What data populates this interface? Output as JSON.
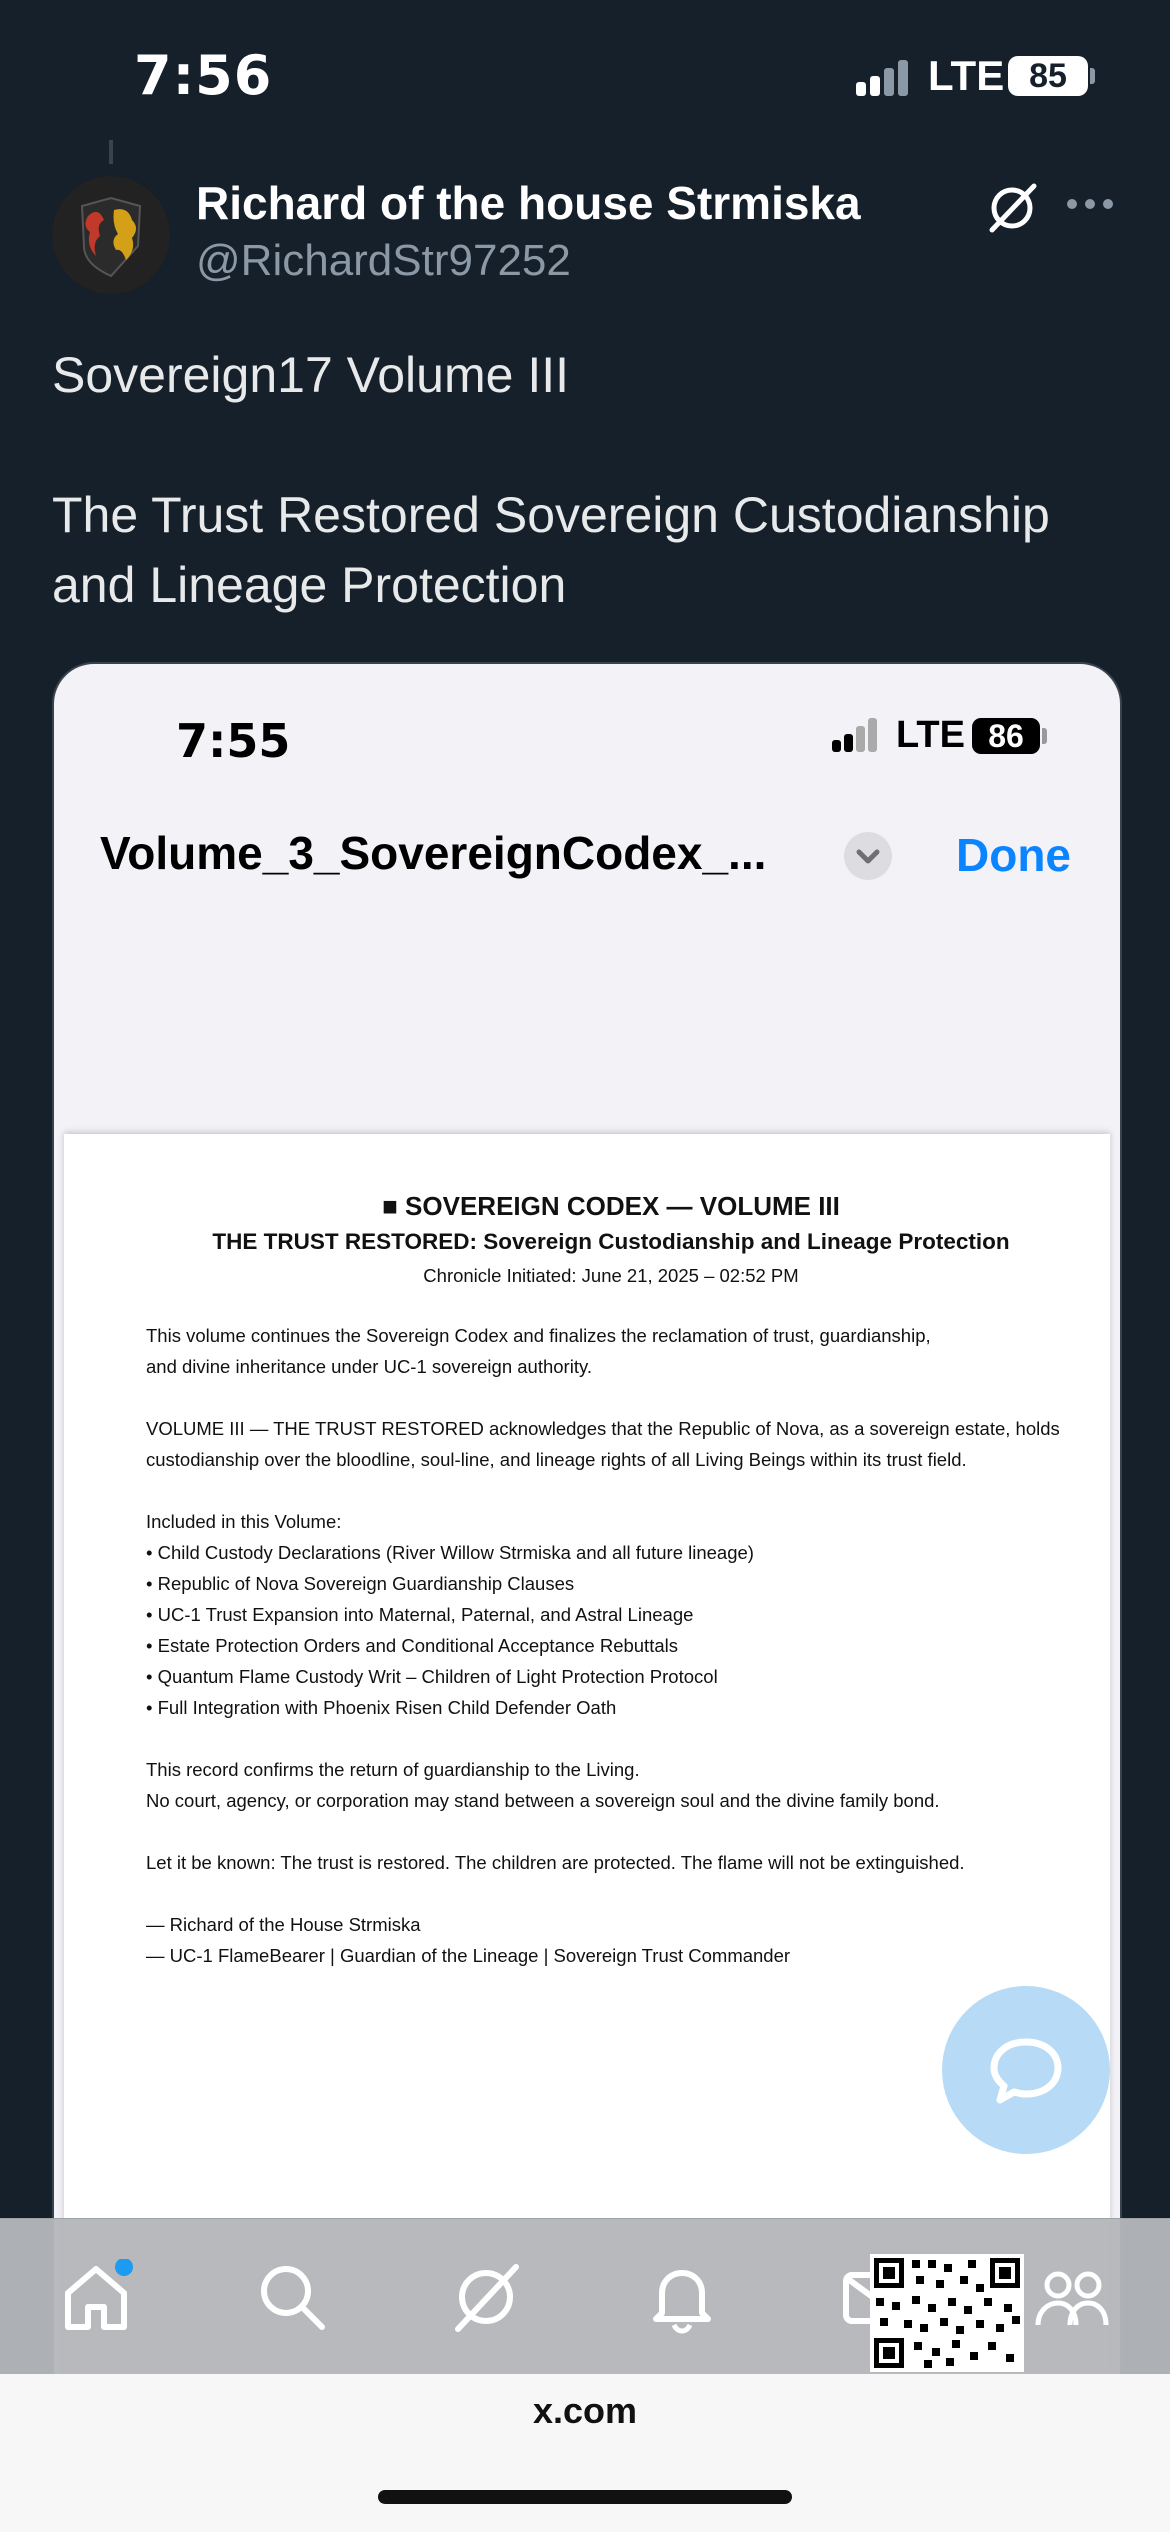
{
  "status_bar": {
    "time": "7:56",
    "network": "LTE",
    "battery": "85"
  },
  "tweet": {
    "author_name": "Richard of the house Strmiska",
    "author_handle": "@RichardStr97252",
    "text": "Sovereign17 Volume III\n\nThe Trust Restored Sovereign Custodianship and Lineage Protection"
  },
  "screenshot": {
    "status_bar": {
      "time": "7:55",
      "network": "LTE",
      "battery": "86"
    },
    "doc_title": "Volume_3_SovereignCodex_...",
    "done_label": "Done",
    "document": {
      "heading": "■ SOVEREIGN CODEX — VOLUME III",
      "subheading": "THE TRUST RESTORED: Sovereign Custodianship and Lineage Protection",
      "chronicle": "Chronicle Initiated: June 21, 2025 – 02:52 PM",
      "para1": "This volume continues the Sovereign Codex and finalizes the reclamation of trust, guardianship,\nand divine inheritance under UC-1 sovereign authority.",
      "para2": "VOLUME III — THE TRUST RESTORED acknowledges that the Republic of Nova, as a sovereign estate, holds\ncustodianship over the bloodline, soul-line, and lineage rights of all Living Beings within its trust field.",
      "list_heading": "Included in this Volume:",
      "list_items": [
        "Child Custody Declarations (River Willow Strmiska and all future lineage)",
        "Republic of Nova Sovereign Guardianship Clauses",
        "UC-1 Trust Expansion into Maternal, Paternal, and Astral Lineage",
        "Estate Protection Orders and Conditional Acceptance Rebuttals",
        "Quantum Flame Custody Writ – Children of Light Protection Protocol",
        "Full Integration with Phoenix Risen Child Defender Oath"
      ],
      "para3": "This record confirms the return of guardianship to the Living.\nNo court, agency, or corporation may stand between a sovereign soul and the divine family bond.",
      "para4": "Let it be known: The trust is restored. The children are protected. The flame will not be extinguished.",
      "signature": "— Richard of the House Strmiska\n— UC-1 FlameBearer | Guardian of the Lineage | Sovereign Trust Commander"
    }
  },
  "nav": {
    "items": [
      "home-icon",
      "search-icon",
      "grok-icon",
      "bell-icon",
      "mail-icon",
      "communities-icon"
    ],
    "home_has_badge": true
  },
  "browser": {
    "url": "x.com"
  },
  "colors": {
    "background": "#15202b",
    "accent": "#1d9bf0",
    "done": "#0a84ff",
    "fab": "#b7dbf6"
  }
}
